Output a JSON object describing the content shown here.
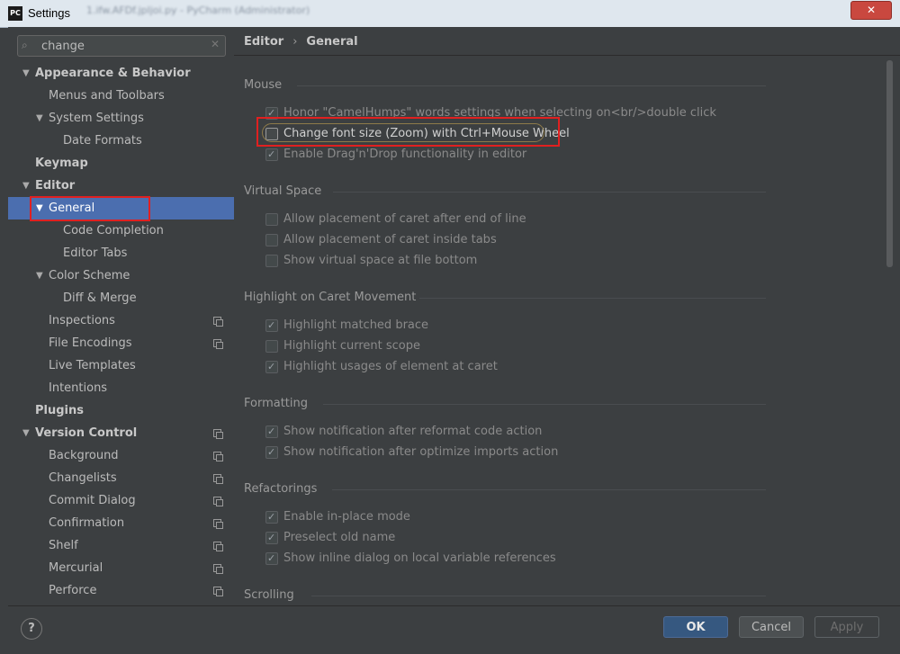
{
  "window": {
    "title": "Settings",
    "logo_text": "PC",
    "blurred_title": "1.ifw.AFDf.jpljoi.py - PyCharm (Administrator)",
    "close_label": "✕"
  },
  "search": {
    "value": "change",
    "placeholder": "",
    "clear_label": "✕",
    "icon": "magnifier-icon"
  },
  "tree": [
    {
      "label": "Appearance & Behavior",
      "level": 0,
      "bold": true,
      "expanded": true
    },
    {
      "label": "Menus and Toolbars",
      "level": 1
    },
    {
      "label": "System Settings",
      "level": 1,
      "expanded": true
    },
    {
      "label": "Date Formats",
      "level": 2
    },
    {
      "label": "Keymap",
      "level": 0,
      "bold": true
    },
    {
      "label": "Editor",
      "level": 0,
      "bold": true,
      "expanded": true
    },
    {
      "label": "General",
      "level": 1,
      "expanded": true,
      "selected": true
    },
    {
      "label": "Code Completion",
      "level": 2
    },
    {
      "label": "Editor Tabs",
      "level": 2
    },
    {
      "label": "Color Scheme",
      "level": 1,
      "expanded": true
    },
    {
      "label": "Diff & Merge",
      "level": 2
    },
    {
      "label": "Inspections",
      "level": 1,
      "project_icon": true
    },
    {
      "label": "File Encodings",
      "level": 1,
      "project_icon": true
    },
    {
      "label": "Live Templates",
      "level": 1
    },
    {
      "label": "Intentions",
      "level": 1
    },
    {
      "label": "Plugins",
      "level": 0,
      "bold": true
    },
    {
      "label": "Version Control",
      "level": 0,
      "bold": true,
      "expanded": true,
      "project_icon": true
    },
    {
      "label": "Background",
      "level": 1,
      "project_icon": true
    },
    {
      "label": "Changelists",
      "level": 1,
      "project_icon": true
    },
    {
      "label": "Commit Dialog",
      "level": 1,
      "project_icon": true
    },
    {
      "label": "Confirmation",
      "level": 1,
      "project_icon": true
    },
    {
      "label": "Shelf",
      "level": 1,
      "project_icon": true
    },
    {
      "label": "Mercurial",
      "level": 1,
      "project_icon": true
    },
    {
      "label": "Perforce",
      "level": 1,
      "project_icon": true
    }
  ],
  "breadcrumb": {
    "part1": "Editor",
    "separator": "›",
    "part2": "General"
  },
  "sections": {
    "mouse": {
      "title": "Mouse",
      "options": [
        {
          "label": "Honor \"CamelHumps\" words settings when selecting on<br/>double click",
          "checked": true
        },
        {
          "label": "Change font size (Zoom) with Ctrl+Mouse Wheel",
          "checked": false
        },
        {
          "label": "Enable Drag'n'Drop functionality in editor",
          "checked": true
        }
      ]
    },
    "virtual_space": {
      "title": "Virtual Space",
      "options": [
        {
          "label": "Allow placement of caret after end of line",
          "checked": false
        },
        {
          "label": "Allow placement of caret inside tabs",
          "checked": false
        },
        {
          "label": "Show virtual space at file bottom",
          "checked": false
        }
      ]
    },
    "highlight": {
      "title": "Highlight on Caret Movement",
      "options": [
        {
          "label": "Highlight matched brace",
          "checked": true
        },
        {
          "label": "Highlight current scope",
          "checked": false
        },
        {
          "label": "Highlight usages of element at caret",
          "checked": true
        }
      ]
    },
    "formatting": {
      "title": "Formatting",
      "options": [
        {
          "label": "Show notification after reformat code action",
          "checked": true
        },
        {
          "label": "Show notification after optimize imports action",
          "checked": true
        }
      ]
    },
    "refactorings": {
      "title": "Refactorings",
      "options": [
        {
          "label": "Enable in-place mode",
          "checked": true
        },
        {
          "label": "Preselect old name",
          "checked": true
        },
        {
          "label": "Show inline dialog on local variable references",
          "checked": true
        }
      ]
    },
    "scrolling": {
      "title": "Scrolling"
    }
  },
  "footer": {
    "help_label": "?",
    "ok_label": "OK",
    "cancel_label": "Cancel",
    "apply_label": "Apply"
  },
  "colors": {
    "selection": "#4b6eaf",
    "highlight_box": "#e02020",
    "ok_button": "#365880"
  }
}
